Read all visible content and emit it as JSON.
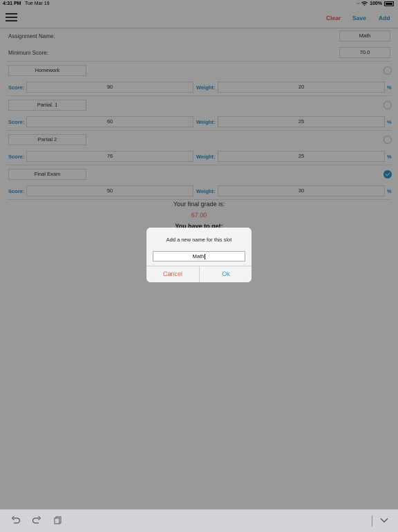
{
  "status": {
    "time": "4:31 PM",
    "date": "Tue Mar 19",
    "battery": "100%"
  },
  "nav": {
    "clear": "Clear",
    "save": "Save",
    "add": "Add"
  },
  "assignment": {
    "label": "Assignment Name:",
    "value": "Math"
  },
  "minimum": {
    "label": "Minimum Score:",
    "value": "70.0"
  },
  "labels": {
    "score": "Score:",
    "weight": "Weight:",
    "percent": "%"
  },
  "slots": [
    {
      "name": "Homework",
      "score": "90",
      "weight": "20",
      "selected": false
    },
    {
      "name": "Partial. 1",
      "score": "60",
      "weight": "25",
      "selected": false
    },
    {
      "name": "Partial 2",
      "score": "76",
      "weight": "25",
      "selected": false
    },
    {
      "name": "Final Exam",
      "score": "50",
      "weight": "30",
      "selected": true
    }
  ],
  "result": {
    "label": "Your final grade is:",
    "grade": "67.00",
    "need_label": "You have to get:"
  },
  "dialog": {
    "message": "Add a new name for this slot",
    "input_value": "Math",
    "cancel": "Cancel",
    "ok": "Ok"
  },
  "toolbar": {
    "undo": "undo-icon",
    "redo": "redo-icon",
    "paste": "paste-icon",
    "dismiss": "chevron-down-icon"
  },
  "colors": {
    "accent": "#2f95c9",
    "danger": "#e05a4a"
  }
}
